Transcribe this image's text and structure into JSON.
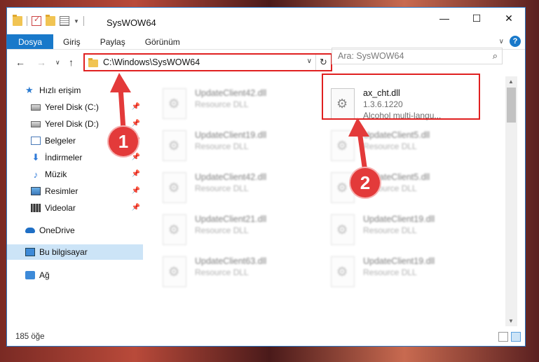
{
  "window": {
    "title": "SysWOW64",
    "controls": {
      "minimize": "—",
      "maximize": "☐",
      "close": "✕"
    }
  },
  "ribbon": {
    "tabs": [
      "Dosya",
      "Giriş",
      "Paylaş",
      "Görünüm"
    ],
    "help_label": "?"
  },
  "navbar": {
    "address": "C:\\Windows\\SysWOW64",
    "search_placeholder": "Ara: SysWOW64"
  },
  "navpane": {
    "quick_access": "Hızlı erişim",
    "items": [
      {
        "label": "Yerel Disk (C:)",
        "icon": "drive-icon",
        "pinned": true
      },
      {
        "label": "Yerel Disk (D:)",
        "icon": "drive-icon",
        "pinned": true
      },
      {
        "label": "Belgeler",
        "icon": "documents-icon",
        "pinned": true
      },
      {
        "label": "İndirmeler",
        "icon": "downloads-icon",
        "pinned": true
      },
      {
        "label": "Müzik",
        "icon": "music-icon",
        "pinned": true
      },
      {
        "label": "Resimler",
        "icon": "pictures-icon",
        "pinned": true
      },
      {
        "label": "Videolar",
        "icon": "videos-icon",
        "pinned": true
      }
    ],
    "onedrive": "OneDrive",
    "this_pc": "Bu bilgisayar",
    "network": "Ağ"
  },
  "files": {
    "left": [
      {
        "name": "UpdateClient42.dll",
        "desc": "Resource DLL"
      },
      {
        "name": "UpdateClient19.dll",
        "desc": "Resource DLL"
      },
      {
        "name": "UpdateClient42.dll",
        "desc": "Resource DLL"
      },
      {
        "name": "UpdateClient21.dll",
        "desc": "Resource DLL"
      },
      {
        "name": "UpdateClient63.dll",
        "desc": "Resource DLL"
      }
    ],
    "right": [
      {
        "name": "ax_cht.dll",
        "version": "1.3.6.1220",
        "desc": "Alcohol multi-langu..."
      },
      {
        "name": "UpdateClient5.dll",
        "desc": "Resource DLL"
      },
      {
        "name": "UpdateClient5.dll",
        "desc": "Resource DLL"
      },
      {
        "name": "UpdateClient19.dll",
        "desc": "Resource DLL"
      },
      {
        "name": "UpdateClient19.dll",
        "desc": "Resource DLL"
      }
    ]
  },
  "status": {
    "count": "185 öğe"
  },
  "callouts": {
    "one": "1",
    "two": "2",
    "color": "#e33a3a"
  }
}
